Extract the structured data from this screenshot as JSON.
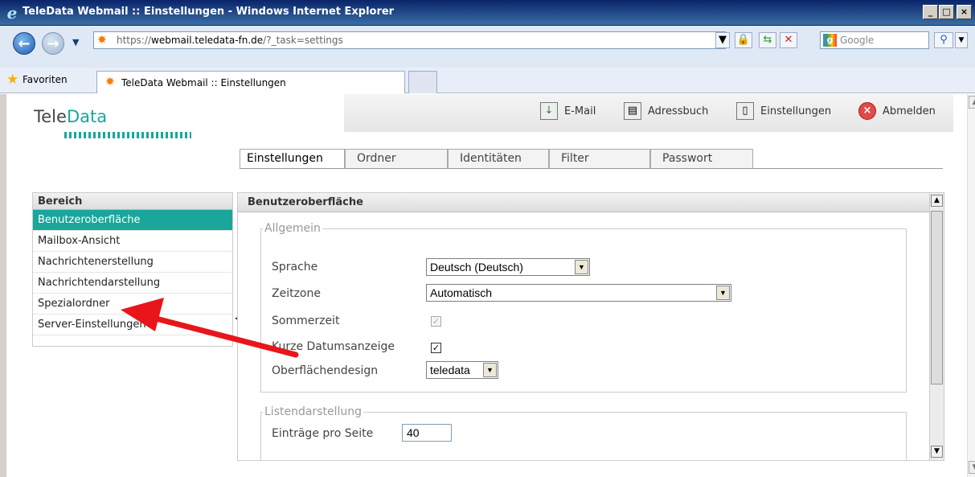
{
  "window": {
    "title": "TeleData Webmail :: Einstellungen - Windows Internet Explorer",
    "minimize": "_",
    "maximize": "□",
    "close": "×"
  },
  "browser": {
    "address_prefix": "https://",
    "address_host": "webmail.teledata-fn.de",
    "address_path": "/?_task=settings",
    "search_placeholder": "Google",
    "favorites_label": "Favoriten",
    "tab_title": "TeleData Webmail :: Einstellungen"
  },
  "app": {
    "logo_part1": "Tele",
    "logo_part2": "Data",
    "toolbar": {
      "email": "E-Mail",
      "addressbook": "Adressbuch",
      "settings": "Einstellungen",
      "logout": "Abmelden"
    },
    "tabs": [
      "Einstellungen",
      "Ordner",
      "Identitäten",
      "Filter",
      "Passwort"
    ],
    "sections": {
      "header": "Bereich",
      "items": [
        "Benutzeroberfläche",
        "Mailbox-Ansicht",
        "Nachrichtenerstellung",
        "Nachrichtendarstellung",
        "Spezialordner",
        "Server-Einstellungen"
      ],
      "selected_index": 0
    },
    "panel": {
      "title": "Benutzeroberfläche",
      "general": {
        "legend": "Allgemein",
        "language_label": "Sprache",
        "language_value": "Deutsch (Deutsch)",
        "timezone_label": "Zeitzone",
        "timezone_value": "Automatisch",
        "dst_label": "Sommerzeit",
        "dst_checked": true,
        "dst_disabled": true,
        "short_date_label": "Kurze Datumsanzeige",
        "short_date_checked": true,
        "skin_label": "Oberflächendesign",
        "skin_value": "teledata"
      },
      "list": {
        "legend": "Listendarstellung",
        "per_page_label": "Einträge pro Seite",
        "per_page_value": "40"
      }
    }
  },
  "colors": {
    "accent": "#1aa69a",
    "annotation_arrow": "#e8161b"
  }
}
